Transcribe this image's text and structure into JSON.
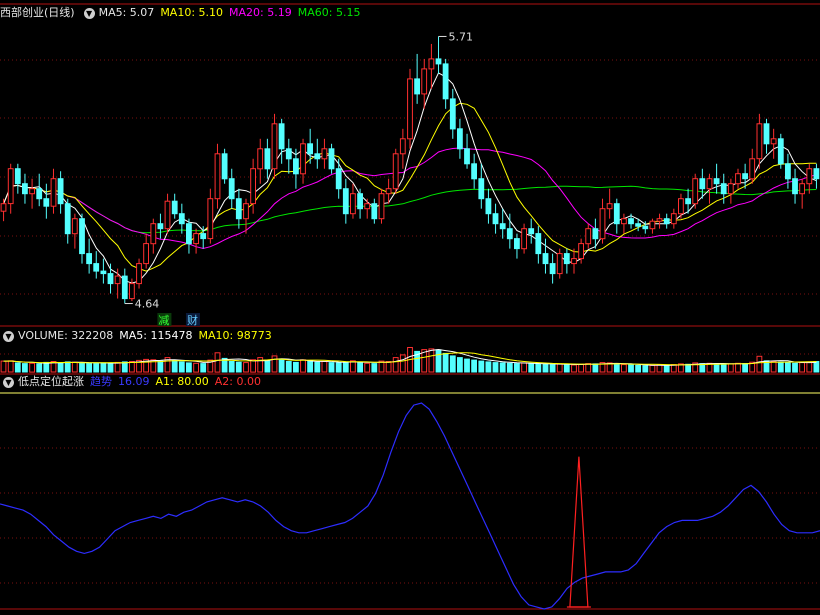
{
  "colors": {
    "up": "#ff3030",
    "down": "#54ffff",
    "ma5": "#ffffff",
    "ma10": "#ffff00",
    "ma20": "#ff00ff",
    "ma60": "#00e600",
    "indicator": "#2d2dff",
    "signal": "#ff2020",
    "divider": "#b01010",
    "grid": "#7a1010"
  },
  "price_header": {
    "stock_name": "西部创业(日线)",
    "ma5": "MA5: 5.07",
    "ma10": "MA10: 5.10",
    "ma20": "MA20: 5.19",
    "ma60": "MA60: 5.15",
    "toggle_icon": "chevron-down-icon"
  },
  "volume_header": {
    "volume": "VOLUME: 322208",
    "ma5": "MA5: 115478",
    "ma10": "MA10: 98773",
    "toggle_icon": "chevron-down-icon"
  },
  "indicator_header": {
    "name": "低点定位起涨",
    "trend": "趋势",
    "trend_value": "16.09",
    "a1": "A1: 80.00",
    "a2": "A2: 0.00",
    "toggle_icon": "chevron-down-icon"
  },
  "annotations": {
    "high_label": "5.71",
    "low_label": "4.64",
    "marker_reduce": "减",
    "marker_wealth": "财"
  },
  "chart_data": [
    {
      "type": "candlestick",
      "panel": "price",
      "ylim": [
        4.55,
        5.84
      ],
      "ohlc": [
        [
          5.01,
          5.06,
          4.97,
          5.04
        ],
        [
          5.04,
          5.2,
          5.0,
          5.18
        ],
        [
          5.18,
          5.2,
          5.08,
          5.12
        ],
        [
          5.12,
          5.16,
          5.04,
          5.08
        ],
        [
          5.08,
          5.14,
          5.02,
          5.1
        ],
        [
          5.1,
          5.16,
          5.03,
          5.06
        ],
        [
          5.06,
          5.12,
          4.98,
          5.03
        ],
        [
          5.03,
          5.18,
          5.0,
          5.14
        ],
        [
          5.14,
          5.17,
          5.0,
          5.04
        ],
        [
          5.04,
          5.06,
          4.88,
          4.92
        ],
        [
          4.92,
          5.0,
          4.86,
          4.98
        ],
        [
          4.98,
          5.0,
          4.8,
          4.84
        ],
        [
          4.84,
          4.9,
          4.76,
          4.8
        ],
        [
          4.8,
          4.85,
          4.74,
          4.77
        ],
        [
          4.77,
          4.82,
          4.72,
          4.76
        ],
        [
          4.76,
          4.8,
          4.68,
          4.72
        ],
        [
          4.72,
          4.78,
          4.66,
          4.75
        ],
        [
          4.75,
          4.78,
          4.64,
          4.66
        ],
        [
          4.66,
          4.74,
          4.65,
          4.72
        ],
        [
          4.72,
          4.82,
          4.7,
          4.8
        ],
        [
          4.8,
          4.92,
          4.78,
          4.88
        ],
        [
          4.88,
          4.98,
          4.84,
          4.96
        ],
        [
          4.96,
          5.0,
          4.9,
          4.94
        ],
        [
          4.94,
          5.08,
          4.92,
          5.05
        ],
        [
          5.05,
          5.08,
          4.98,
          5.0
        ],
        [
          5.0,
          5.04,
          4.92,
          4.96
        ],
        [
          4.96,
          4.98,
          4.84,
          4.88
        ],
        [
          4.88,
          4.94,
          4.84,
          4.92
        ],
        [
          4.92,
          4.95,
          4.86,
          4.9
        ],
        [
          4.9,
          5.1,
          4.88,
          5.06
        ],
        [
          5.06,
          5.28,
          5.02,
          5.24
        ],
        [
          5.24,
          5.26,
          5.12,
          5.14
        ],
        [
          5.14,
          5.18,
          5.02,
          5.06
        ],
        [
          5.06,
          5.1,
          4.94,
          4.98
        ],
        [
          4.98,
          5.06,
          4.92,
          5.04
        ],
        [
          5.04,
          5.22,
          5.0,
          5.18
        ],
        [
          5.18,
          5.3,
          5.12,
          5.26
        ],
        [
          5.26,
          5.3,
          5.14,
          5.18
        ],
        [
          5.18,
          5.4,
          5.14,
          5.36
        ],
        [
          5.36,
          5.38,
          5.2,
          5.26
        ],
        [
          5.26,
          5.3,
          5.16,
          5.22
        ],
        [
          5.22,
          5.26,
          5.1,
          5.16
        ],
        [
          5.16,
          5.3,
          5.12,
          5.28
        ],
        [
          5.28,
          5.34,
          5.2,
          5.24
        ],
        [
          5.24,
          5.3,
          5.18,
          5.22
        ],
        [
          5.22,
          5.3,
          5.18,
          5.26
        ],
        [
          5.26,
          5.28,
          5.16,
          5.18
        ],
        [
          5.18,
          5.22,
          5.06,
          5.1
        ],
        [
          5.1,
          5.14,
          4.96,
          5.0
        ],
        [
          5.0,
          5.12,
          4.98,
          5.08
        ],
        [
          5.08,
          5.1,
          4.98,
          5.02
        ],
        [
          5.02,
          5.06,
          4.98,
          5.04
        ],
        [
          5.04,
          5.06,
          4.96,
          4.98
        ],
        [
          4.98,
          5.1,
          4.96,
          5.08
        ],
        [
          5.08,
          5.14,
          5.04,
          5.1
        ],
        [
          5.1,
          5.26,
          5.08,
          5.24
        ],
        [
          5.24,
          5.34,
          5.18,
          5.3
        ],
        [
          5.3,
          5.58,
          5.26,
          5.54
        ],
        [
          5.54,
          5.64,
          5.44,
          5.48
        ],
        [
          5.48,
          5.62,
          5.42,
          5.58
        ],
        [
          5.58,
          5.68,
          5.5,
          5.62
        ],
        [
          5.62,
          5.71,
          5.56,
          5.6
        ],
        [
          5.6,
          5.62,
          5.42,
          5.46
        ],
        [
          5.46,
          5.5,
          5.3,
          5.34
        ],
        [
          5.34,
          5.38,
          5.22,
          5.26
        ],
        [
          5.26,
          5.32,
          5.18,
          5.2
        ],
        [
          5.2,
          5.24,
          5.1,
          5.14
        ],
        [
          5.14,
          5.2,
          5.02,
          5.06
        ],
        [
          5.06,
          5.1,
          4.96,
          5.0
        ],
        [
          5.0,
          5.04,
          4.92,
          4.96
        ],
        [
          4.96,
          5.02,
          4.9,
          4.94
        ],
        [
          4.94,
          5.0,
          4.86,
          4.9
        ],
        [
          4.9,
          4.92,
          4.82,
          4.86
        ],
        [
          4.86,
          4.96,
          4.84,
          4.94
        ],
        [
          4.94,
          4.98,
          4.88,
          4.92
        ],
        [
          4.92,
          4.95,
          4.8,
          4.84
        ],
        [
          4.84,
          4.9,
          4.76,
          4.8
        ],
        [
          4.8,
          4.84,
          4.72,
          4.76
        ],
        [
          4.76,
          4.86,
          4.74,
          4.84
        ],
        [
          4.84,
          4.86,
          4.76,
          4.8
        ],
        [
          4.8,
          4.86,
          4.76,
          4.82
        ],
        [
          4.82,
          4.9,
          4.8,
          4.88
        ],
        [
          4.88,
          4.96,
          4.86,
          4.94
        ],
        [
          4.94,
          4.98,
          4.86,
          4.9
        ],
        [
          4.9,
          5.06,
          4.88,
          5.02
        ],
        [
          5.02,
          5.1,
          4.98,
          5.04
        ],
        [
          5.04,
          5.06,
          4.92,
          4.96
        ],
        [
          4.96,
          5.0,
          4.92,
          4.98
        ],
        [
          4.98,
          5.0,
          4.94,
          4.96
        ],
        [
          4.96,
          4.98,
          4.93,
          4.95
        ],
        [
          4.95,
          4.97,
          4.92,
          4.94
        ],
        [
          4.94,
          4.98,
          4.92,
          4.97
        ],
        [
          4.97,
          5.0,
          4.94,
          4.98
        ],
        [
          4.98,
          5.0,
          4.94,
          4.96
        ],
        [
          4.96,
          5.02,
          4.94,
          5.0
        ],
        [
          5.0,
          5.08,
          4.98,
          5.06
        ],
        [
          5.06,
          5.1,
          5.0,
          5.04
        ],
        [
          5.04,
          5.16,
          5.02,
          5.14
        ],
        [
          5.14,
          5.18,
          5.06,
          5.1
        ],
        [
          5.1,
          5.16,
          5.04,
          5.14
        ],
        [
          5.14,
          5.2,
          5.08,
          5.12
        ],
        [
          5.12,
          5.16,
          5.04,
          5.08
        ],
        [
          5.08,
          5.14,
          5.04,
          5.12
        ],
        [
          5.12,
          5.18,
          5.1,
          5.16
        ],
        [
          5.16,
          5.2,
          5.1,
          5.14
        ],
        [
          5.14,
          5.26,
          5.12,
          5.22
        ],
        [
          5.22,
          5.4,
          5.18,
          5.36
        ],
        [
          5.36,
          5.38,
          5.24,
          5.28
        ],
        [
          5.28,
          5.34,
          5.22,
          5.3
        ],
        [
          5.3,
          5.32,
          5.18,
          5.2
        ],
        [
          5.2,
          5.24,
          5.1,
          5.14
        ],
        [
          5.14,
          5.18,
          5.04,
          5.08
        ],
        [
          5.08,
          5.14,
          5.02,
          5.12
        ],
        [
          5.12,
          5.2,
          5.08,
          5.18
        ],
        [
          5.18,
          5.2,
          5.1,
          5.14
        ]
      ],
      "high_marker": 5.71,
      "low_marker": 4.64
    },
    {
      "type": "bar",
      "panel": "volume",
      "ylim": [
        0,
        160000
      ],
      "values": [
        62000,
        64000,
        52000,
        48000,
        50000,
        46000,
        55000,
        60000,
        52000,
        58000,
        56000,
        54000,
        50000,
        48000,
        52000,
        50000,
        55000,
        58000,
        60000,
        66000,
        72000,
        70000,
        62000,
        82000,
        66000,
        58000,
        52000,
        50000,
        48000,
        68000,
        110000,
        78000,
        60000,
        56000,
        54000,
        70000,
        82000,
        64000,
        92000,
        70000,
        60000,
        55000,
        70000,
        62000,
        56000,
        60000,
        54000,
        52000,
        58000,
        64000,
        54000,
        50000,
        48000,
        62000,
        60000,
        82000,
        98000,
        140000,
        118000,
        128000,
        132000,
        126000,
        106000,
        92000,
        82000,
        74000,
        68000,
        62000,
        58000,
        54000,
        52000,
        50000,
        48000,
        52000,
        48000,
        46000,
        44000,
        42000,
        46000,
        42000,
        40000,
        44000,
        48000,
        46000,
        54000,
        52000,
        46000,
        42000,
        40000,
        38000,
        36000,
        38000,
        40000,
        38000,
        42000,
        46000,
        44000,
        52000,
        48000,
        50000,
        48000,
        44000,
        46000,
        50000,
        48000,
        56000,
        90000,
        64000,
        60000,
        56000,
        52000,
        50000,
        54000,
        58000,
        60000
      ]
    },
    {
      "type": "line",
      "panel": "indicator",
      "ylim": [
        0,
        100
      ],
      "values": [
        51,
        50,
        49,
        48,
        46,
        43,
        40,
        36,
        33,
        30,
        28,
        27,
        28,
        30,
        34,
        38,
        40,
        42,
        43,
        44,
        45,
        44,
        46,
        45,
        47,
        48,
        50,
        52,
        53,
        54,
        53,
        52,
        53,
        52,
        50,
        47,
        43,
        40,
        38,
        37,
        37,
        38,
        39,
        40,
        41,
        42,
        44,
        47,
        50,
        56,
        65,
        76,
        86,
        94,
        99,
        100,
        97,
        91,
        84,
        76,
        68,
        60,
        52,
        44,
        36,
        28,
        20,
        12,
        6,
        2,
        1,
        0,
        1,
        5,
        10,
        13,
        15,
        16,
        17,
        18,
        18,
        18,
        19,
        22,
        27,
        32,
        37,
        40,
        42,
        43,
        43,
        43,
        44,
        45,
        47,
        50,
        54,
        58,
        60,
        57,
        52,
        46,
        41,
        38,
        37,
        37,
        37,
        38
      ],
      "signal": {
        "at": 0.706,
        "peak": 74
      }
    }
  ]
}
